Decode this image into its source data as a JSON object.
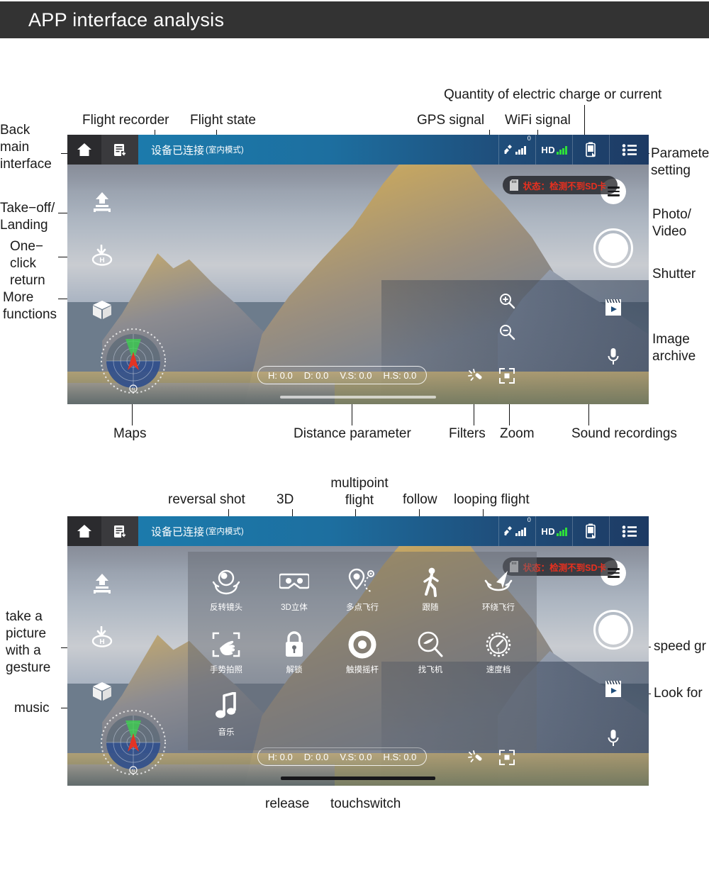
{
  "page": {
    "title": "APP interface analysis"
  },
  "app": {
    "statusbar": {
      "home_icon": "home-icon",
      "recorder_icon": "flight-recorder-icon",
      "status_main": "设备已连接",
      "status_sub": "(室内模式)",
      "gps_icon": "satellite-icon",
      "gps_count": "0",
      "wifi_label": "HD",
      "battery_icon": "battery-icon",
      "menu_icon": "list-menu-icon"
    },
    "warning": {
      "icon": "sd-card-icon",
      "text": "状态：检测不到SD卡"
    },
    "left_tools": [
      {
        "name": "takeoff-landing",
        "icon": "takeoff-icon"
      },
      {
        "name": "one-click-return",
        "icon": "return-home-icon"
      },
      {
        "name": "more-functions",
        "icon": "cube-icon"
      }
    ],
    "right_tools": [
      {
        "name": "photo-video-mode",
        "icon": "mode-toggle-icon"
      },
      {
        "name": "shutter",
        "icon": "shutter-icon"
      },
      {
        "name": "image-archive",
        "icon": "film-play-icon"
      },
      {
        "name": "sound-recording",
        "icon": "microphone-icon"
      }
    ],
    "zoom_controls": [
      {
        "name": "zoom-in",
        "icon": "magnifier-plus-icon"
      },
      {
        "name": "zoom-out",
        "icon": "magnifier-minus-icon"
      }
    ],
    "telemetry": [
      {
        "key": "H",
        "value": "H: 0.0"
      },
      {
        "key": "D",
        "value": "D: 0.0"
      },
      {
        "key": "VS",
        "value": "V.S: 0.0"
      },
      {
        "key": "HS",
        "value": "H.S: 0.0"
      }
    ],
    "bottom_icons": [
      {
        "name": "filters",
        "icon": "magic-wand-icon"
      },
      {
        "name": "zoom-frame",
        "icon": "zoom-brackets-icon"
      }
    ],
    "radar": {
      "name": "map-radar-widget"
    }
  },
  "function_menu": {
    "items": [
      {
        "icon": "reverse-camera-icon",
        "label": "反转镜头"
      },
      {
        "icon": "vr-goggles-icon",
        "label": "3D立体"
      },
      {
        "icon": "waypoint-pin-icon",
        "label": "多点飞行"
      },
      {
        "icon": "walking-person-icon",
        "label": "跟随"
      },
      {
        "icon": "orbit-plane-icon",
        "label": "环绕飞行"
      },
      {
        "icon": "gesture-hand-icon",
        "label": "手势拍照"
      },
      {
        "icon": "padlock-icon",
        "label": "解锁"
      },
      {
        "icon": "joystick-icon",
        "label": "触摸摇杆"
      },
      {
        "icon": "find-plane-icon",
        "label": "找飞机"
      },
      {
        "icon": "speedometer-icon",
        "label": "速度档"
      },
      {
        "icon": "music-note-icon",
        "label": "音乐"
      }
    ]
  },
  "annotations": {
    "panel1": {
      "back_main_interface": "Back\nmain\ninterface",
      "flight_recorder": "Flight recorder",
      "flight_state": "Flight state",
      "gps_signal": "GPS signal",
      "wifi_signal": "WiFi signal",
      "battery": "Quantity of electric charge or current",
      "parameter_setting": "Parameter\nsetting",
      "takeoff_landing": "Take−off/\nLanding",
      "one_click_return": "One−\nclick\nreturn",
      "more_functions": "More\nfunctions",
      "photo_video": "Photo/\nVideo",
      "shutter": "Shutter",
      "image_archive": "Image\narchive",
      "maps": "Maps",
      "distance_parameter": "Distance parameter",
      "filters": "Filters",
      "zoom": "Zoom",
      "sound_recordings": "Sound recordings"
    },
    "panel2": {
      "reversal_shot": "reversal shot",
      "three_d": "3D",
      "multipoint_flight": "multipoint\nflight",
      "follow": "follow",
      "looping_flight": "looping flight",
      "gesture_picture": "take a\npicture\nwith a\ngesture",
      "music": "music",
      "speed_gear": "speed gr",
      "look_for": "Look for",
      "release": "release",
      "touchswitch": "touchswitch"
    }
  }
}
